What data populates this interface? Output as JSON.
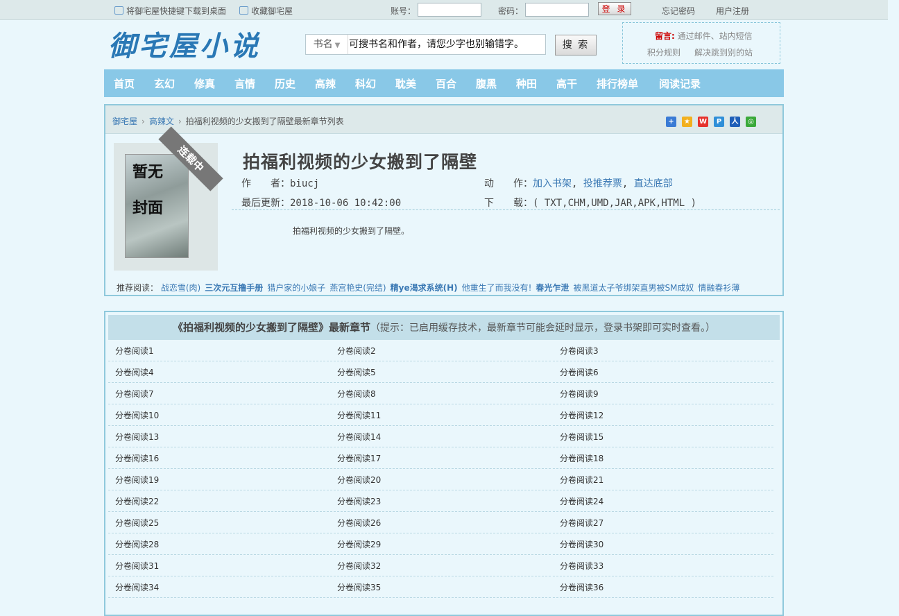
{
  "topbar": {
    "shortcut_label": "将御宅屋快捷键下载到桌面",
    "bookmark_label": "收藏御宅屋",
    "account_label": "账号：",
    "password_label": "密码：",
    "login_label": "登 录",
    "forgot_label": "忘记密码",
    "register_label": "用户注册"
  },
  "header": {
    "logo": "御宅屋小说",
    "search_category": "书名",
    "search_placeholder": "可搜书名和作者，请您少字也别输错字。",
    "search_button": "搜 索",
    "notice_label": "留言:",
    "notice_text": "通过邮件、站内短信",
    "notice_link1": "积分规则",
    "notice_link2": "解决跳到别的站"
  },
  "nav": [
    "首页",
    "玄幻",
    "修真",
    "言情",
    "历史",
    "高辣",
    "科幻",
    "耽美",
    "百合",
    "腹黑",
    "种田",
    "高干",
    "排行榜单",
    "阅读记录"
  ],
  "breadcrumb": {
    "home": "御宅屋",
    "category": "高辣文",
    "current": "拍福利视频的少女搬到了隔壁最新章节列表"
  },
  "book": {
    "cover_text": "暂无封面",
    "status_ribbon": "连载中",
    "title": "拍福利视频的少女搬到了隔壁",
    "author_label": "作　　者：",
    "author": "biucj",
    "action_label": "动　　作：",
    "action_shelf": "加入书架",
    "action_vote": "投推荐票",
    "action_bottom": "直达底部",
    "updated_label": "最后更新：",
    "updated": "2018-10-06 10:42:00",
    "download_label": "下　　载：",
    "download_formats": "( TXT,CHM,UMD,JAR,APK,HTML )",
    "intro": "拍福利视频的少女搬到了隔壁。"
  },
  "recommend": {
    "label": "推荐阅读：",
    "items": [
      "战恋雪(肉)",
      "三次元互撸手册",
      "猎户家的小娘子",
      "燕宫艳史(完结)",
      "精ye渴求系统(H)",
      "他重生了而我没有!",
      "春光乍泄",
      "被黑道太子爷绑架直男被SM成奴",
      "情融春衫薄"
    ]
  },
  "chapters": {
    "book_title": "《拍福利视频的少女搬到了隔壁》最新章节",
    "tip": "（提示：已启用缓存技术，最新章节可能会延时显示，登录书架即可实时查看。）",
    "items": [
      "分卷阅读1",
      "分卷阅读2",
      "分卷阅读3",
      "分卷阅读4",
      "分卷阅读5",
      "分卷阅读6",
      "分卷阅读7",
      "分卷阅读8",
      "分卷阅读9",
      "分卷阅读10",
      "分卷阅读11",
      "分卷阅读12",
      "分卷阅读13",
      "分卷阅读14",
      "分卷阅读15",
      "分卷阅读16",
      "分卷阅读17",
      "分卷阅读18",
      "分卷阅读19",
      "分卷阅读20",
      "分卷阅读21",
      "分卷阅读22",
      "分卷阅读23",
      "分卷阅读24",
      "分卷阅读25",
      "分卷阅读26",
      "分卷阅读27",
      "分卷阅读28",
      "分卷阅读29",
      "分卷阅读30",
      "分卷阅读31",
      "分卷阅读32",
      "分卷阅读33",
      "分卷阅读34",
      "分卷阅读35",
      "分卷阅读36"
    ]
  },
  "colors": {
    "nav_bg": "#89c8e7",
    "link": "#3b79b4",
    "border": "#8fc9dc",
    "page_bg": "#eaf7fc"
  }
}
